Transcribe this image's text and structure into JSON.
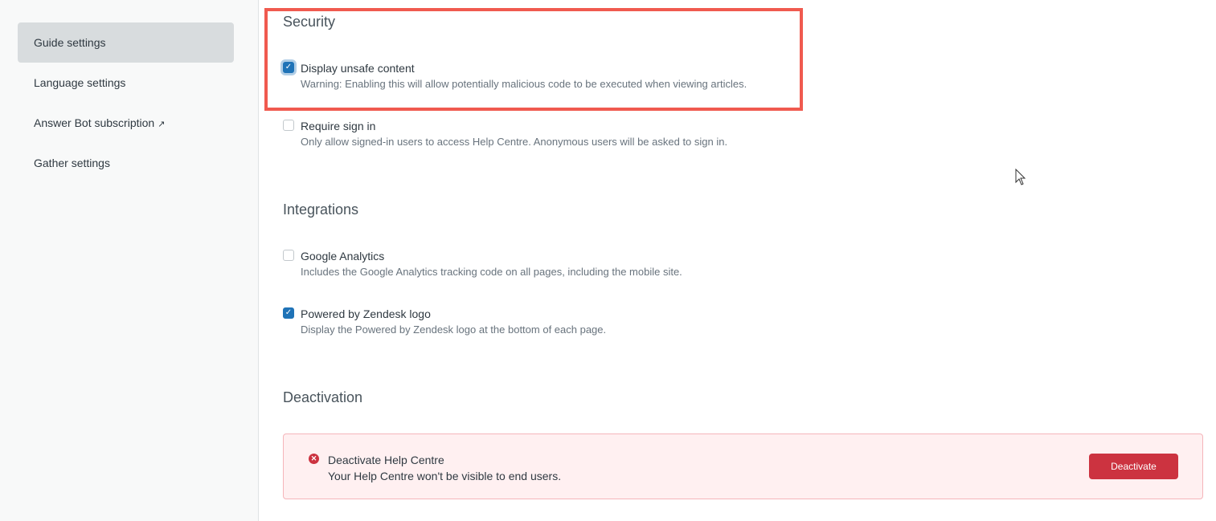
{
  "sidebar": {
    "items": [
      {
        "label": "Guide settings",
        "active": true
      },
      {
        "label": "Language settings"
      },
      {
        "label": "Answer Bot subscription",
        "icon": "external-link-icon"
      },
      {
        "label": "Gather settings"
      }
    ]
  },
  "security": {
    "title": "Security",
    "options": [
      {
        "label": "Display unsafe content",
        "desc": "Warning: Enabling this will allow potentially malicious code to be executed when viewing articles.",
        "checked": true
      },
      {
        "label": "Require sign in",
        "desc": "Only allow signed-in users to access Help Centre. Anonymous users will be asked to sign in.",
        "checked": false
      }
    ]
  },
  "integrations": {
    "title": "Integrations",
    "options": [
      {
        "label": "Google Analytics",
        "desc": "Includes the Google Analytics tracking code on all pages, including the mobile site.",
        "checked": false
      },
      {
        "label": "Powered by Zendesk logo",
        "desc": "Display the Powered by Zendesk logo at the bottom of each page.",
        "checked": true
      }
    ]
  },
  "deactivation": {
    "title": "Deactivation",
    "alert_title": "Deactivate Help Centre",
    "alert_desc": "Your Help Centre won't be visible to end users.",
    "button": "Deactivate"
  },
  "colors": {
    "accent": "#1f73b7",
    "danger": "#cc3340",
    "highlight": "#f05a4f"
  }
}
